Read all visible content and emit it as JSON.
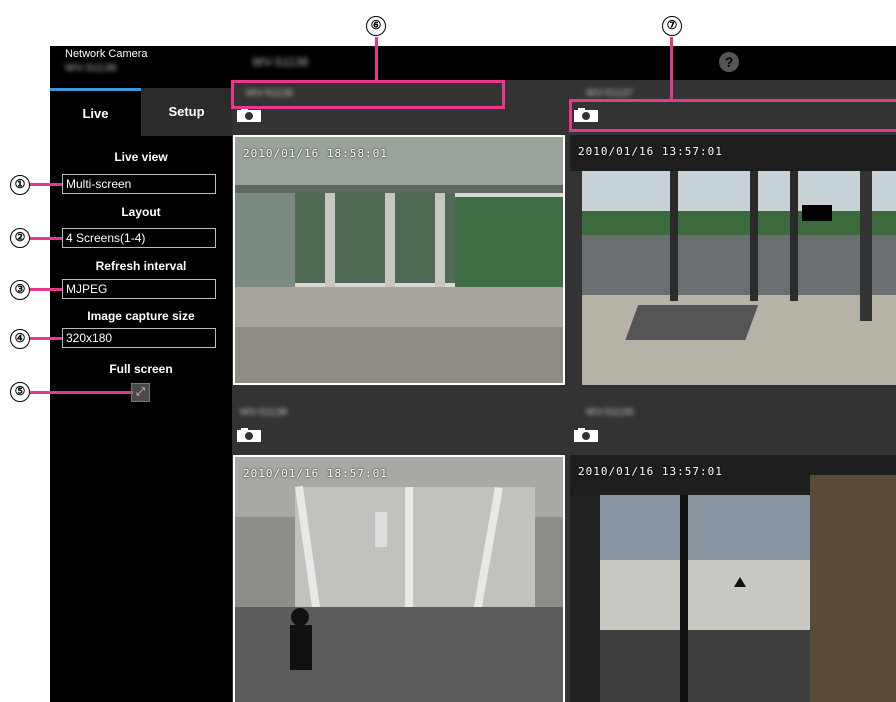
{
  "app": {
    "title": "Network Camera",
    "model": "WV-S1136",
    "help_icon": "?"
  },
  "tabs": {
    "live": "Live",
    "setup": "Setup"
  },
  "sidebar": {
    "live_view": {
      "label": "Live view",
      "value": "Multi-screen"
    },
    "layout": {
      "label": "Layout",
      "value": "4 Screens(1-4)"
    },
    "refresh": {
      "label": "Refresh interval",
      "value": "MJPEG"
    },
    "capture_size": {
      "label": "Image capture size",
      "value": "320x180"
    },
    "full_screen": {
      "label": "Full screen"
    }
  },
  "cameras": [
    {
      "title": "WV-S1136",
      "timestamp": "2010/01/16 18:58:01"
    },
    {
      "title": "WV-S1137",
      "timestamp": "2010/01/16 13:57:01"
    },
    {
      "title": "WV-S1138",
      "timestamp": "2010/01/16 18:57:01"
    },
    {
      "title": "WV-S1139",
      "timestamp": "2010/01/16 13:57:01"
    }
  ],
  "callouts": [
    "①",
    "②",
    "③",
    "④",
    "⑤",
    "⑥",
    "⑦"
  ],
  "colors": {
    "accent": "#e6398e",
    "tab_accent": "#3a9ad9"
  }
}
